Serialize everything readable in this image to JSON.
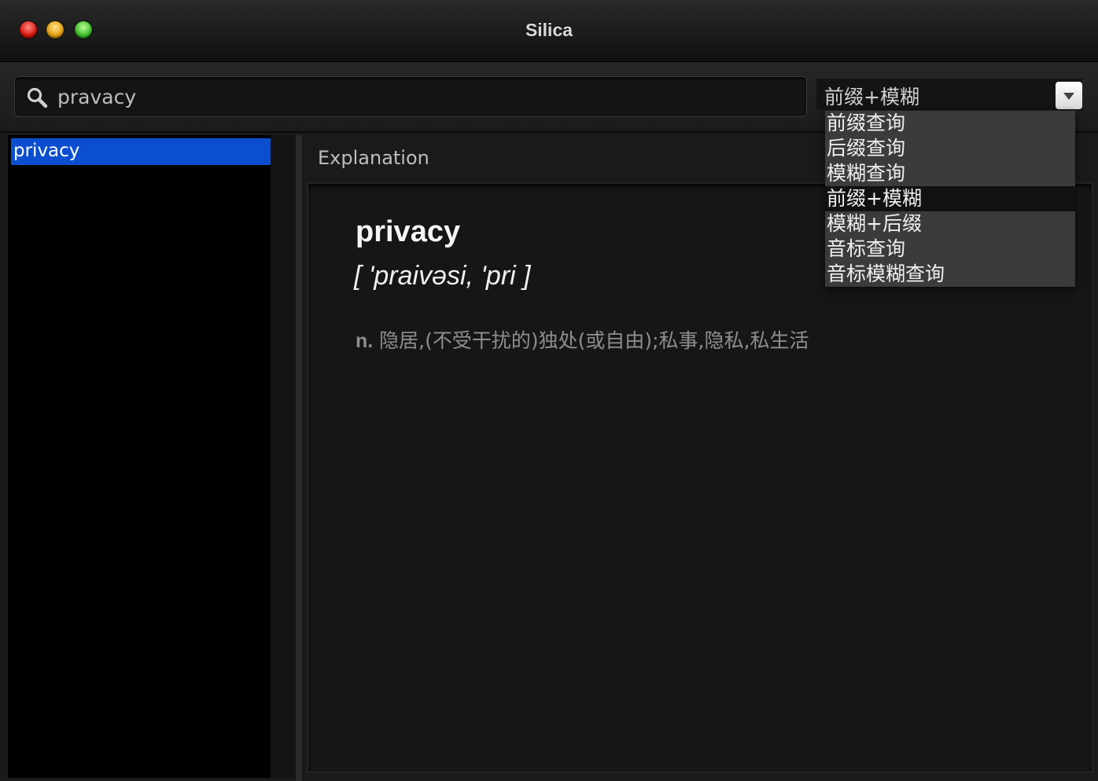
{
  "window": {
    "title": "Silica"
  },
  "toolbar": {
    "search": {
      "value": "pravacy",
      "placeholder": ""
    },
    "mode_select": {
      "selected": "前缀+模糊",
      "options": [
        "前缀查询",
        "后缀查询",
        "模糊查询",
        "前缀+模糊",
        "模糊+后缀",
        "音标查询",
        "音标模糊查询"
      ]
    }
  },
  "sidebar": {
    "items": [
      {
        "label": "privacy",
        "selected": true
      }
    ]
  },
  "explanation": {
    "header": "Explanation",
    "word": "privacy",
    "phonetic": "[ 'praivəsi, 'pri ]",
    "part_of_speech": "n.",
    "definition": "隐居,(不受干扰的)独处(或自由);私事,隐私,私生活"
  },
  "colors": {
    "selection": "#0b4fd0",
    "background": "#1a1a1a"
  }
}
